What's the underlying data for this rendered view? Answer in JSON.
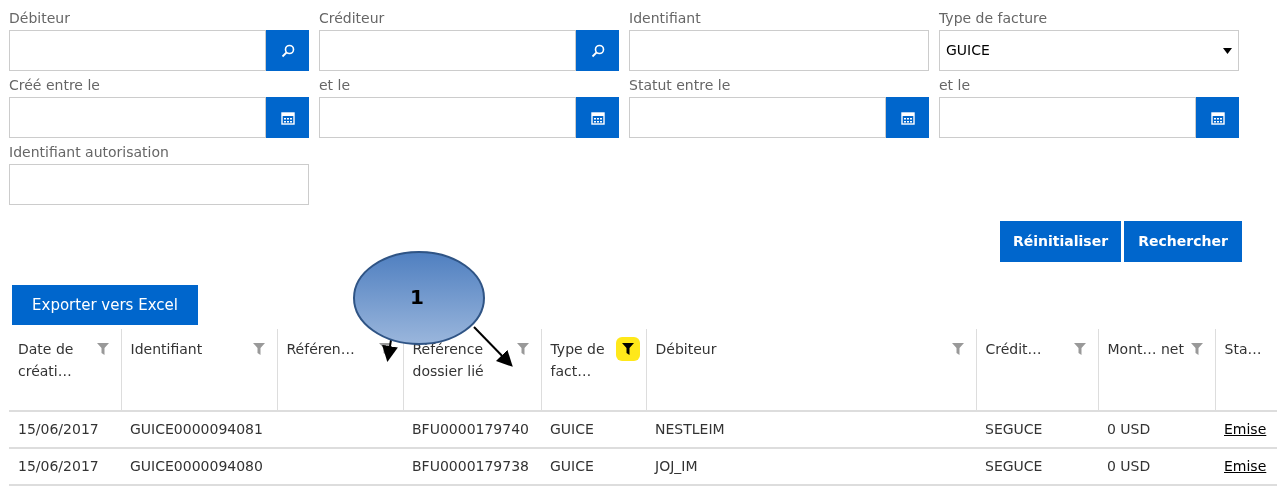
{
  "filters": [
    {
      "label": "Débiteur",
      "kind": "search"
    },
    {
      "label": "Créditeur",
      "kind": "search"
    },
    {
      "label": "Identifiant",
      "kind": "text"
    },
    {
      "label": "Type de facture",
      "kind": "select",
      "value": "GUICE"
    },
    {
      "label": "Créé entre le",
      "kind": "date"
    },
    {
      "label": "et le",
      "kind": "date"
    },
    {
      "label": "Statut entre le",
      "kind": "date"
    },
    {
      "label": "et le",
      "kind": "date"
    },
    {
      "label": "Identifiant autorisation",
      "kind": "text"
    }
  ],
  "actions": [
    "Réinitialiser",
    "Rechercher"
  ],
  "export_button": "Exporter vers Excel",
  "callout": "1",
  "table": {
    "columns": [
      {
        "label": "Date de créati…",
        "filtered": false
      },
      {
        "label": "Identifiant",
        "filtered": false
      },
      {
        "label": "Référen…",
        "filtered": false
      },
      {
        "label": "Référence dossier lié",
        "filtered": false
      },
      {
        "label": "Type de fact…",
        "filtered": true
      },
      {
        "label": "Débiteur",
        "filtered": false
      },
      {
        "label": "Crédit…",
        "filtered": false
      },
      {
        "label": "Mont… net",
        "filtered": false
      },
      {
        "label": "Sta…"
      }
    ],
    "rows": [
      [
        "15/06/2017",
        "GUICE0000094081",
        "",
        "BFU0000179740",
        "GUICE",
        "NESTLEIM",
        "SEGUCE",
        "0 USD",
        "Emise"
      ],
      [
        "15/06/2017",
        "GUICE0000094080",
        "",
        "BFU0000179738",
        "GUICE",
        "JOJ_IM",
        "SEGUCE",
        "0 USD",
        "Emise"
      ]
    ]
  }
}
